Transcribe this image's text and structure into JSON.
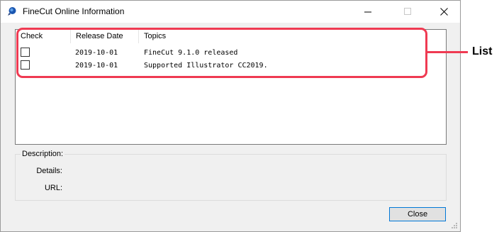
{
  "window": {
    "title": "FineCut Online Information",
    "app_icon": "finecut-icon",
    "controls": {
      "minimize_icon": "minimize-icon",
      "maximize_icon": "maximize-icon",
      "close_icon": "close-icon"
    }
  },
  "list": {
    "columns": [
      "Check",
      "Release Date",
      "Topics"
    ],
    "rows": [
      {
        "checked": false,
        "date": "2019-10-01",
        "topic": "FineCut 9.1.0 released"
      },
      {
        "checked": false,
        "date": "2019-10-01",
        "topic": "Supported Illustrator CC2019."
      }
    ]
  },
  "annotation": {
    "label": "List",
    "color": "#ef3a52"
  },
  "description": {
    "title": "Description:",
    "details_label": "Details:",
    "details_value": "",
    "url_label": "URL:",
    "url_value": ""
  },
  "buttons": {
    "close_label": "Close"
  },
  "colors": {
    "window_bg": "#f0f0f0",
    "focus_border": "#0078d7"
  }
}
